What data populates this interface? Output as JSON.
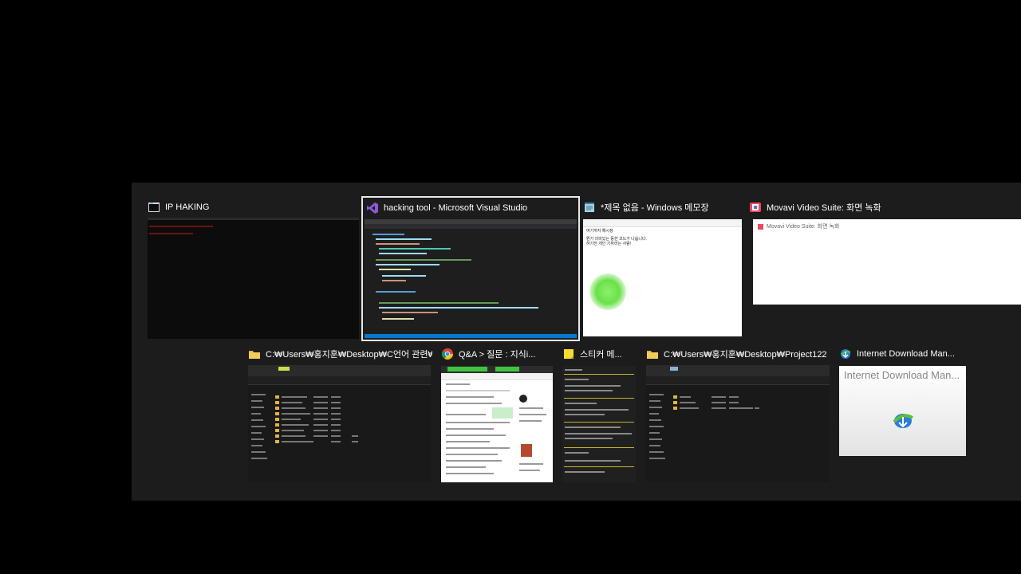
{
  "switcher": {
    "windows": [
      {
        "title": "IP HAKING",
        "icon": "console-icon",
        "selected": false
      },
      {
        "title": "hacking tool - Microsoft Visual Studio",
        "icon": "visual-studio-icon",
        "selected": true
      },
      {
        "title": "*제목 없음 - Windows 메모장",
        "icon": "notepad-icon",
        "selected": false
      },
      {
        "title": "Movavi Video Suite: 화면 녹화",
        "icon": "movavi-icon",
        "selected": false
      },
      {
        "title": "C:₩Users₩홍지훈₩Desktop₩C언어 관련₩...",
        "icon": "folder-icon",
        "selected": false
      },
      {
        "title": "Q&A > 질문 : 지식i...",
        "icon": "chrome-icon",
        "selected": false
      },
      {
        "title": "스티커 메...",
        "icon": "sticky-note-icon",
        "selected": false
      },
      {
        "title": "C:₩Users₩홍지훈₩Desktop₩Project122",
        "icon": "folder-icon",
        "selected": false
      },
      {
        "title": "Internet Download Man...",
        "icon": "idm-icon",
        "selected": false
      }
    ],
    "notepad_text": [
      "여기까지 해시정",
      "뭔가 의미있는 동한 코드가 나옵니다.",
      "하기전 개인 기하라는 사람!"
    ],
    "movavi_thumb_title": "Movavi Video Suite: 화면 녹화",
    "idm_thumb_title": "Internet Download Man..."
  },
  "colors": {
    "selected_outline": "#e8e8e8",
    "switcher_bg": "#1c1c1c",
    "vs_accent": "#007acc",
    "folder": "#e2b440",
    "sticky_accent": "#c7b32a"
  }
}
